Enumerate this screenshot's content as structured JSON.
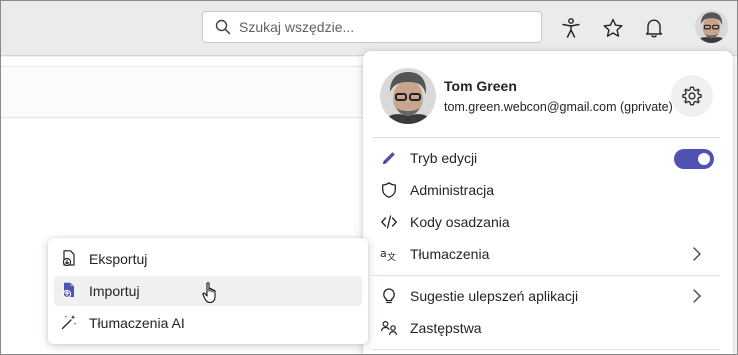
{
  "search": {
    "placeholder": "Szukaj wszędzie..."
  },
  "topbar": {
    "icons": [
      "accessibility-icon",
      "star-icon",
      "bell-icon",
      "avatar"
    ]
  },
  "profile": {
    "name": "Tom Green",
    "email": "tom.green.webcon@gmail.com (gprivate)"
  },
  "menu": {
    "items": [
      {
        "label": "Tryb edycji",
        "icon": "pencil-icon",
        "toggle": true
      },
      {
        "label": "Administracja",
        "icon": "shield-icon"
      },
      {
        "label": "Kody osadzania",
        "icon": "code-icon"
      },
      {
        "label": "Tłumaczenia",
        "icon": "translate-icon",
        "submenu": true
      },
      {
        "label": "Sugestie ulepszeń aplikacji",
        "icon": "lightbulb-icon",
        "submenu": true
      },
      {
        "label": "Zastępstwa",
        "icon": "people-swap-icon"
      }
    ]
  },
  "submenu": {
    "items": [
      {
        "label": "Eksportuj",
        "icon": "export-icon"
      },
      {
        "label": "Importuj",
        "icon": "import-icon"
      },
      {
        "label": "Tłumaczenia AI",
        "icon": "magic-wand-icon"
      }
    ]
  },
  "colors": {
    "accent": "#4f52b2",
    "panel_bg": "#ffffff",
    "topbar_bg": "#ebebeb"
  }
}
